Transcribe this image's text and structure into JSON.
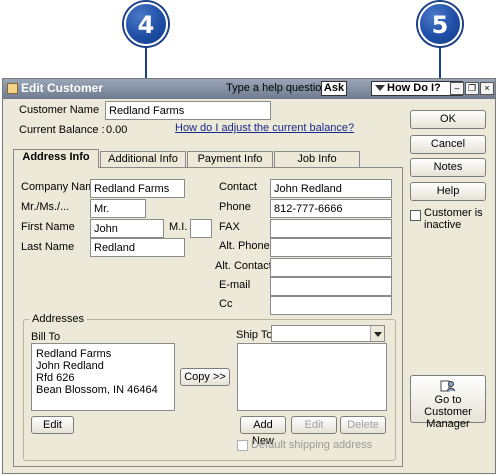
{
  "callouts": {
    "four": "4",
    "five": "5"
  },
  "window": {
    "title": "Edit Customer",
    "help_label": "Type a help question",
    "ask_label": "Ask",
    "howdoi_label": "How Do I?",
    "buttons": {
      "minimize": "‒",
      "restore": "❐",
      "close": "×"
    }
  },
  "header": {
    "customer_name_label": "Customer Name",
    "customer_name_value": "Redland Farms",
    "balance_label": "Current Balance :",
    "balance_value": "0.00",
    "balance_link": "How do I adjust the current balance?"
  },
  "tabs": [
    {
      "label": "Address Info"
    },
    {
      "label": "Additional Info"
    },
    {
      "label": "Payment Info"
    },
    {
      "label": "Job Info"
    }
  ],
  "form": {
    "company_label": "Company Name",
    "company_value": "Redland Farms",
    "mr_label": "Mr./Ms./...",
    "mr_value": "Mr.",
    "first_label": "First Name",
    "first_value": "John",
    "mi_label": "M.I.",
    "mi_value": "",
    "last_label": "Last Name",
    "last_value": "Redland",
    "contact_label": "Contact",
    "contact_value": "John Redland",
    "phone_label": "Phone",
    "phone_value": "812-777-6666",
    "fax_label": "FAX",
    "fax_value": "",
    "altphone_label": "Alt. Phone",
    "altphone_value": "",
    "altcontact_label": "Alt. Contact",
    "altcontact_value": "",
    "email_label": "E-mail",
    "email_value": "",
    "cc_label": "Cc",
    "cc_value": ""
  },
  "addresses": {
    "group_label": "Addresses",
    "bill_to_label": "Bill To",
    "bill_to_lines": [
      "Redland Farms",
      "John Redland",
      "Rfd 626",
      "Bean Blossom, IN 46464"
    ],
    "copy_label": "Copy >>",
    "edit_label": "Edit",
    "ship_to_label": "Ship To",
    "ship_to_value": "",
    "add_new_label": "Add New",
    "ship_edit_label": "Edit",
    "delete_label": "Delete",
    "default_shipping_label": "Default shipping address"
  },
  "side": {
    "ok_label": "OK",
    "cancel_label": "Cancel",
    "notes_label": "Notes",
    "help_label": "Help",
    "inactive_label_1": "Customer is",
    "inactive_label_2": "inactive",
    "goto_label_1": "Go to Customer",
    "goto_label_2": "Manager"
  }
}
